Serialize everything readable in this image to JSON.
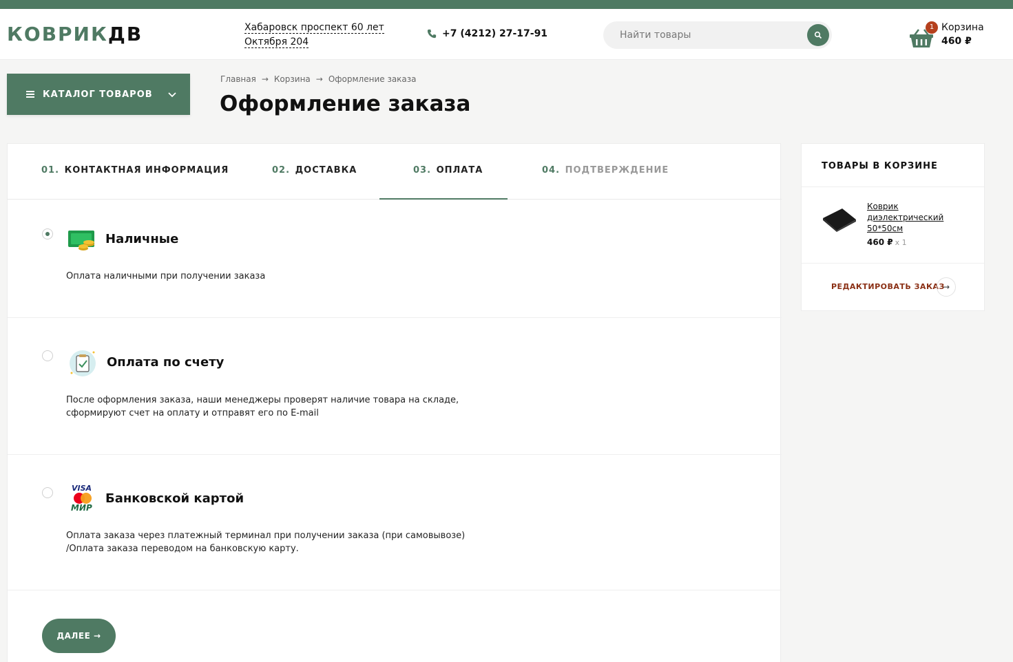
{
  "header": {
    "logo_part1": "КОВРИК",
    "logo_part2": "ДВ",
    "address_line1": "Хабаровск проспект 60 лет",
    "address_line2": "Октября 204",
    "phone": "+7 (4212) 27-17-91",
    "search_placeholder": "Найти товары",
    "cart_label": "Корзина",
    "cart_count": "1",
    "cart_sum": "460 ₽"
  },
  "catalog_button": "КАТАЛОГ ТОВАРОВ",
  "breadcrumb": [
    "Главная",
    "Корзина",
    "Оформление заказа"
  ],
  "breadcrumb_sep": "→",
  "page_title": "Оформление заказа",
  "steps": [
    {
      "num": "01.",
      "label": "КОНТАКТНАЯ ИНФОРМАЦИЯ"
    },
    {
      "num": "02.",
      "label": "ДОСТАВКА"
    },
    {
      "num": "03.",
      "label": "ОПЛАТА"
    },
    {
      "num": "04.",
      "label": "ПОДТВЕРЖДЕНИЕ"
    }
  ],
  "payment_options": [
    {
      "title": "Наличные",
      "desc_line1": "Оплата наличными при получении заказа",
      "desc_line2": "",
      "selected": true,
      "icon": "cash-icon"
    },
    {
      "title": "Оплата по счету",
      "desc_line1": "После оформления заказа, наши менеджеры проверят наличие товара на складе,",
      "desc_line2": "сформируют счет на оплату и отправят его по E-mail",
      "selected": false,
      "icon": "invoice-icon"
    },
    {
      "title": "Банковской картой",
      "desc_line1": "Оплата заказа через платежный терминал при получении заказа (при самовывозе)",
      "desc_line2": "/Оплата заказа переводом на банковскую карту.",
      "selected": false,
      "icon": "card-icon"
    }
  ],
  "card_logo": {
    "visa": "VISA",
    "mir": "МИР"
  },
  "next_button": "ДАЛЕЕ →",
  "sidebar": {
    "title": "ТОВАРЫ В КОРЗИНЕ",
    "product_name": "Коврик диэлектрический 50*50см",
    "product_price": "460 ₽",
    "product_qty": "x 1",
    "edit_label": "РЕДАКТИРОВАТЬ ЗАКАЗ",
    "edit_arrow": "→"
  },
  "colors": {
    "accent": "#4f7a63",
    "badge": "#b5401d",
    "edit_link": "#8a2f14"
  }
}
